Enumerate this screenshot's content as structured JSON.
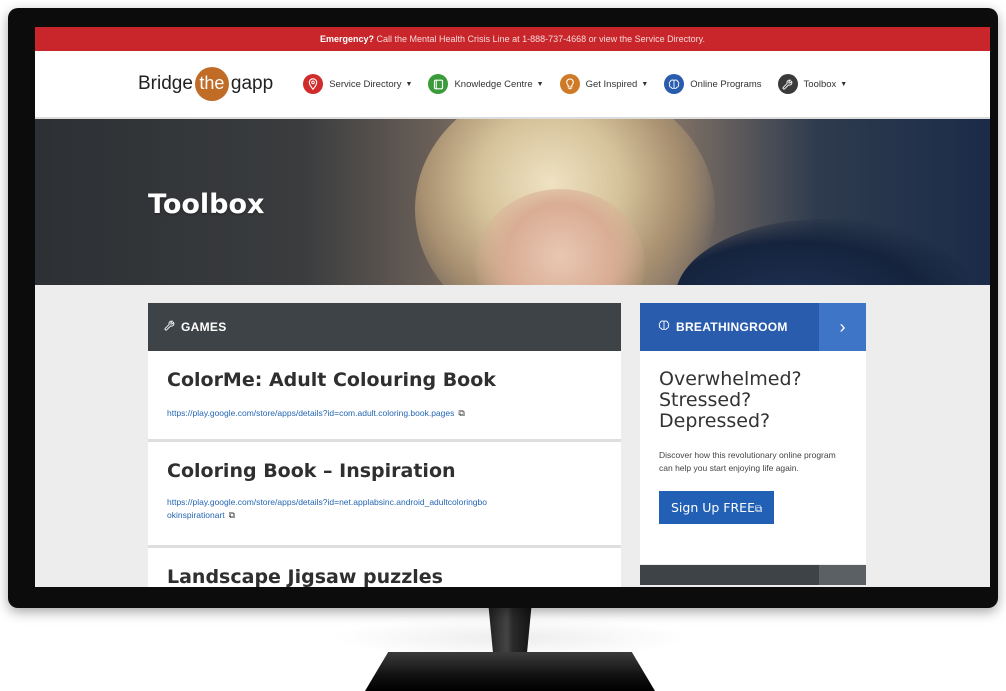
{
  "emergency": {
    "strong": "Emergency?",
    "text": " Call the Mental Health Crisis Line at 1-888-737-4668 or view the Service Directory."
  },
  "logo": {
    "pre": "Bridge",
    "mid": "the",
    "post": "gapp"
  },
  "nav": [
    {
      "label": "Service Directory",
      "icon": "map-pin-icon",
      "color": "#d02c2c",
      "dropdown": true
    },
    {
      "label": "Knowledge Centre",
      "icon": "book-icon",
      "color": "#3b9a3a",
      "dropdown": true
    },
    {
      "label": "Get Inspired",
      "icon": "lightbulb-icon",
      "color": "#cf7a26",
      "dropdown": true
    },
    {
      "label": "Online Programs",
      "icon": "brain-icon",
      "color": "#2a5cad",
      "dropdown": false
    },
    {
      "label": "Toolbox",
      "icon": "wrench-icon",
      "color": "#3a3a3a",
      "dropdown": true
    }
  ],
  "hero": {
    "title": "Toolbox"
  },
  "games": {
    "header": "GAMES",
    "items": [
      {
        "title": "ColorMe: Adult Colouring Book",
        "link": "https://play.google.com/store/apps/details?id=com.adult.coloring.book.pages"
      },
      {
        "title": "Coloring Book – Inspiration",
        "link": "https://play.google.com/store/apps/details?id=net.applabsinc.android_adultcoloringbookinspirationart"
      },
      {
        "title": "Landscape Jigsaw puzzles",
        "link": ""
      }
    ]
  },
  "sidebar": {
    "header": "BREATHINGROOM",
    "headline": "Overwhelmed? Stressed? Depressed?",
    "body": "Discover how this revolutionary online program can help you start enjoying life again.",
    "cta": "Sign Up FREE"
  },
  "colors": {
    "emergency_bar": "#c9262c",
    "games_header": "#3d4346",
    "sidebar_header": "#2a5cad",
    "button": "#2160b4",
    "link": "#2466b3"
  }
}
